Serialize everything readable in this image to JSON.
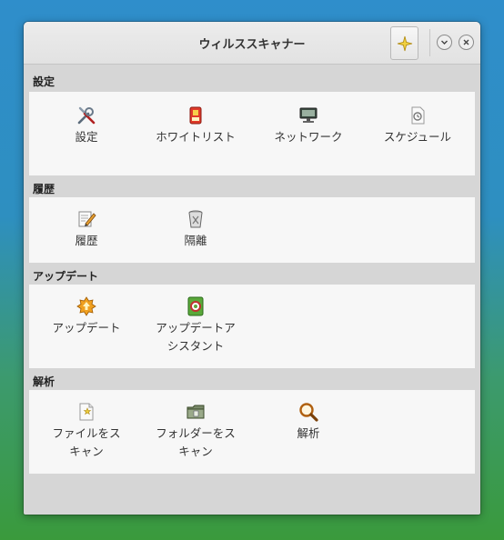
{
  "window": {
    "title": "ウィルススキャナー"
  },
  "sections": [
    {
      "heading": "設定",
      "items": [
        {
          "label": "設定",
          "icon": "tools-icon"
        },
        {
          "label": "ホワイトリスト",
          "icon": "whitelist-icon"
        },
        {
          "label": "ネットワーク",
          "icon": "network-icon"
        },
        {
          "label": "スケジュール",
          "icon": "schedule-icon"
        }
      ]
    },
    {
      "heading": "履歴",
      "items": [
        {
          "label": "履歴",
          "icon": "history-icon"
        },
        {
          "label": "隔離",
          "icon": "quarantine-icon"
        }
      ]
    },
    {
      "heading": "アップデート",
      "items": [
        {
          "label": "アップデート",
          "icon": "update-icon"
        },
        {
          "label": "アップデートアシスタント",
          "line1": "アップデートア",
          "line2": "シスタント",
          "icon": "update-assistant-icon"
        }
      ]
    },
    {
      "heading": "解析",
      "items": [
        {
          "label": "ファイルをスキャン",
          "line1": "ファイルをス",
          "line2": "キャン",
          "icon": "scan-file-icon"
        },
        {
          "label": "フォルダーをスキャン",
          "line1": "フォルダーをス",
          "line2": "キャン",
          "icon": "scan-folder-icon"
        },
        {
          "label": "解析",
          "icon": "analysis-icon"
        }
      ]
    }
  ],
  "colors": {
    "accent_star": "#e8c020",
    "panel_bg": "#f7f7f7",
    "window_bg": "#d6d6d6"
  }
}
